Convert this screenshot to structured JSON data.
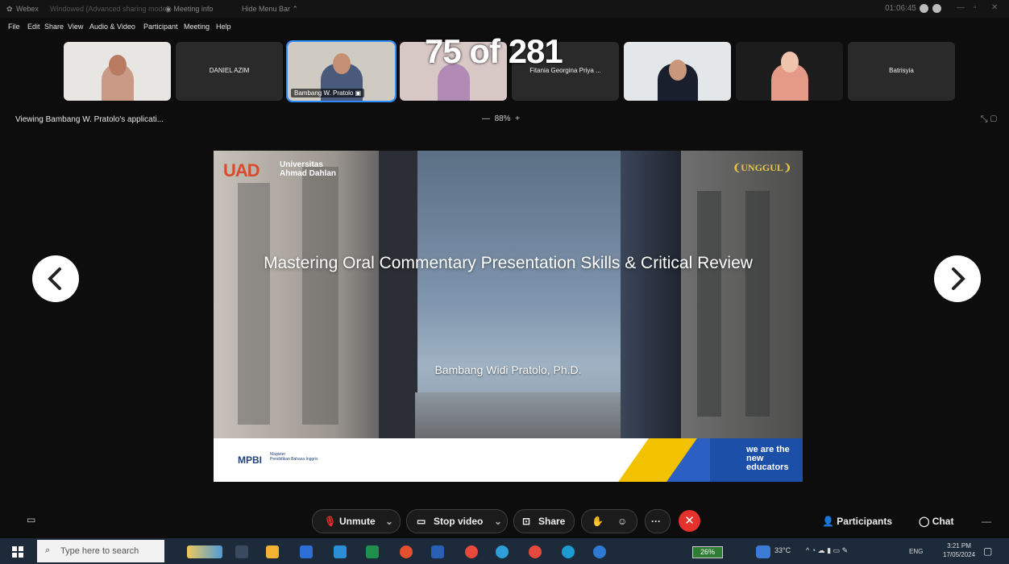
{
  "titlebar": {
    "app": "Webex",
    "mode": "Windowed (Advanced sharing mode)",
    "meeting_info": "Meeting info",
    "hide_menu": "Hide Menu Bar",
    "clock": "01:06:45"
  },
  "menu": [
    "File",
    "Edit",
    "Share",
    "View",
    "Audio & Video",
    "Participant",
    "Meeting",
    "Help"
  ],
  "participants": [
    {
      "name": "",
      "video": true
    },
    {
      "name": "DANIEL AZIM",
      "video": false
    },
    {
      "name": "Bambang W. Pratolo",
      "video": true,
      "selected": true
    },
    {
      "name": "",
      "video": true
    },
    {
      "name": "Fitania Georgina Priya ...",
      "video": false
    },
    {
      "name": "",
      "video": true
    },
    {
      "name": "",
      "video": true
    },
    {
      "name": "Batrisyia",
      "video": false
    }
  ],
  "counter": "75 of 281",
  "viewing": "Viewing Bambang W. Pratolo's applicati...",
  "zoom": "88%",
  "slide": {
    "logo_text": "UAD",
    "university_line1": "Universitas",
    "university_line2": "Ahmad Dahlan",
    "badge": "UNGGUL",
    "title": "Mastering Oral Commentary Presentation Skills & Critical Review",
    "author": "Bambang Widi Pratolo, Ph.D.",
    "footer_logo": "MPBI",
    "footer_sub1": "Magister",
    "footer_sub2": "Pendidikan Bahasa Inggris",
    "tagline": "we are the new educators"
  },
  "controls": {
    "unmute": "Unmute",
    "stop_video": "Stop video",
    "share": "Share",
    "participants": "Participants",
    "chat": "Chat"
  },
  "taskbar": {
    "search_placeholder": "Type here to search",
    "battery": "26%",
    "temperature": "33°C",
    "language": "ENG",
    "time": "3:21 PM",
    "date": "17/05/2024"
  },
  "colors": {
    "accent": "#2d8cff",
    "end": "#e5322d",
    "slide_blue": "#1c4fa8",
    "slide_gold": "#f2c200"
  }
}
